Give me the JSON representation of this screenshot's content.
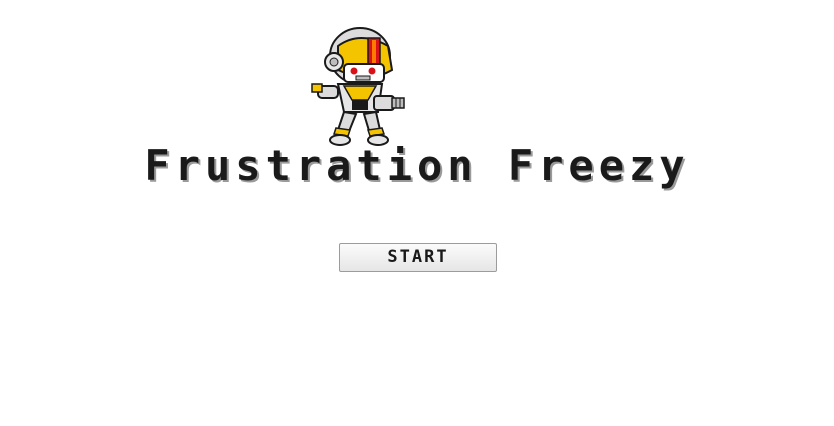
{
  "game": {
    "title": "Frustration Freezy",
    "start_label": "START"
  },
  "character": {
    "icon": "robot-mech-character-icon",
    "colors": {
      "primary": "#f5c400",
      "visor": "#d9121a",
      "armor": "#d8d8d8",
      "outline": "#1a1a1a"
    }
  }
}
